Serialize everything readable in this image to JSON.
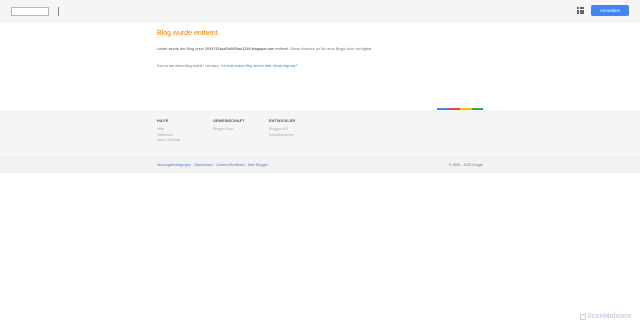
{
  "header": {
    "signin_label": "Anmelden",
    "apps_icon": "apps-grid-icon"
  },
  "main": {
    "title": "Blog wurde entfernt.",
    "message_prefix": "Leider wurde der Blog unter ",
    "blog_host": "2034792zip00d002tsu1249.blogspot.com",
    "message_mid": " entfernt.",
    "message_suffix": " Diese Adresse ist für neue Blogs nicht verfügbar.",
    "owner_text": "Hast du hier deinen Blog erstellt? Lies dazu, ",
    "owner_link": "\"Ich finde meinen Blog nicht im Web. Woran liegt das?\""
  },
  "colorbar": [
    "#4285f4",
    "#ea4335",
    "#fbbc05",
    "#34a853"
  ],
  "footer": {
    "columns": [
      {
        "heading": "HILFE",
        "links": [
          "Hilfe",
          "Hilfeforum",
          "Video-Tutorials"
        ]
      },
      {
        "heading": "GEMEINSCHAFT",
        "links": [
          "Blogger-Buzz"
        ]
      },
      {
        "heading": "ENTWICKLER",
        "links": [
          "Blogger-API",
          "Entwicklerforum"
        ]
      }
    ]
  },
  "bottom": {
    "links": [
      "Nutzungsbedingungen",
      "Datenschutz",
      "Content-Richtlinien",
      "Über Blogger"
    ],
    "copyright": "© 1999 – 2023 Google"
  },
  "watermark": "ScanMalware"
}
